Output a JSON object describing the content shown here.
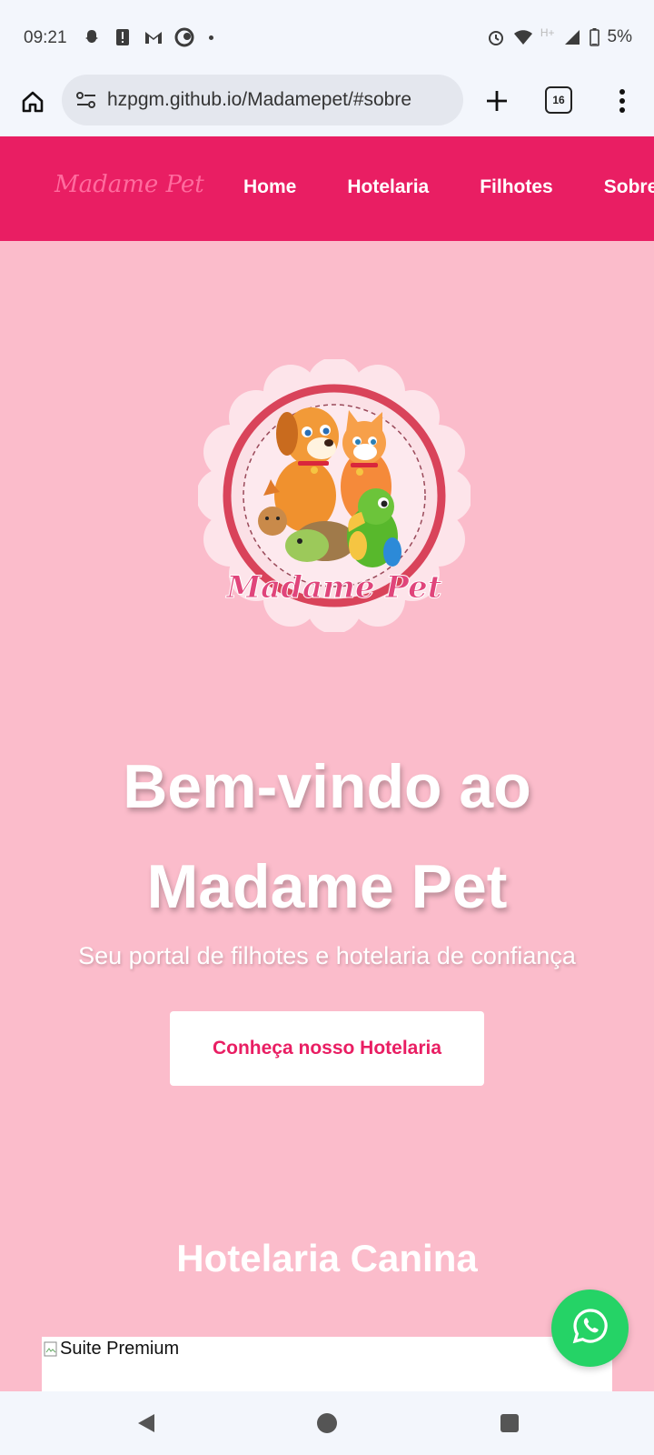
{
  "status_bar": {
    "time": "09:21",
    "left_icons": [
      "snapchat-icon",
      "alert-icon",
      "gmail-icon",
      "sync-icon"
    ],
    "network": "H+",
    "battery": "5%"
  },
  "browser": {
    "url": "hzpgm.github.io/Madamepet/#sobre",
    "tab_count": "16"
  },
  "nav": {
    "logo": "Madame Pet",
    "links": [
      "Home",
      "Hotelaria",
      "Filhotes",
      "Sobre"
    ]
  },
  "hero": {
    "logo_text": "Madame Pet",
    "title_line1": "Bem-vindo ao",
    "title_line2": "Madame Pet",
    "subtitle": "Seu portal de filhotes e hotelaria de confiança",
    "cta": "Conheça nosso Hotelaria"
  },
  "section": {
    "title": "Hotelaria Canina",
    "card_image_alt": "Suite Premium"
  },
  "colors": {
    "brand": "#e91e63",
    "background": "#fbbccb",
    "whatsapp": "#25d366"
  }
}
